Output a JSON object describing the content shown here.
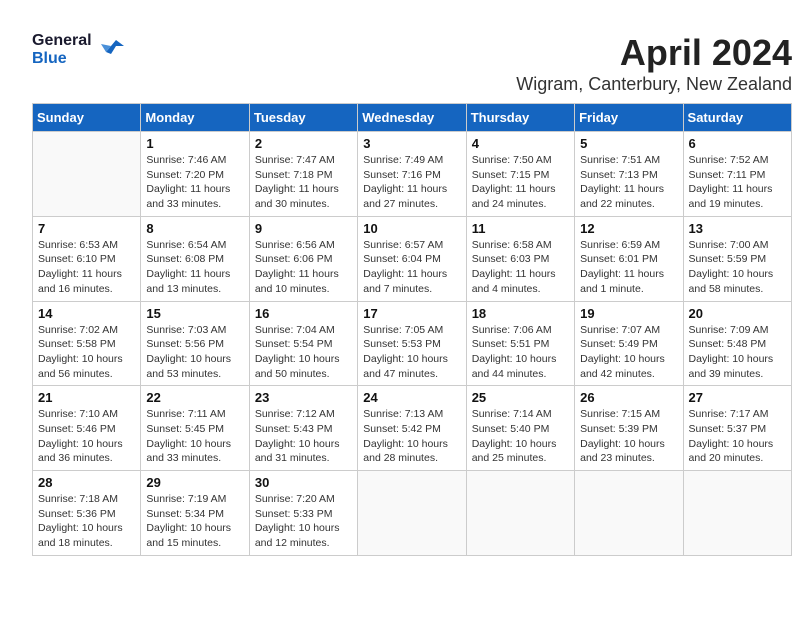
{
  "logo": {
    "general": "General",
    "blue": "Blue"
  },
  "header": {
    "month_year": "April 2024",
    "location": "Wigram, Canterbury, New Zealand"
  },
  "weekdays": [
    "Sunday",
    "Monday",
    "Tuesday",
    "Wednesday",
    "Thursday",
    "Friday",
    "Saturday"
  ],
  "weeks": [
    [
      {
        "day": "",
        "sunrise": "",
        "sunset": "",
        "daylight": ""
      },
      {
        "day": "1",
        "sunrise": "Sunrise: 7:46 AM",
        "sunset": "Sunset: 7:20 PM",
        "daylight": "Daylight: 11 hours and 33 minutes."
      },
      {
        "day": "2",
        "sunrise": "Sunrise: 7:47 AM",
        "sunset": "Sunset: 7:18 PM",
        "daylight": "Daylight: 11 hours and 30 minutes."
      },
      {
        "day": "3",
        "sunrise": "Sunrise: 7:49 AM",
        "sunset": "Sunset: 7:16 PM",
        "daylight": "Daylight: 11 hours and 27 minutes."
      },
      {
        "day": "4",
        "sunrise": "Sunrise: 7:50 AM",
        "sunset": "Sunset: 7:15 PM",
        "daylight": "Daylight: 11 hours and 24 minutes."
      },
      {
        "day": "5",
        "sunrise": "Sunrise: 7:51 AM",
        "sunset": "Sunset: 7:13 PM",
        "daylight": "Daylight: 11 hours and 22 minutes."
      },
      {
        "day": "6",
        "sunrise": "Sunrise: 7:52 AM",
        "sunset": "Sunset: 7:11 PM",
        "daylight": "Daylight: 11 hours and 19 minutes."
      }
    ],
    [
      {
        "day": "7",
        "sunrise": "Sunrise: 6:53 AM",
        "sunset": "Sunset: 6:10 PM",
        "daylight": "Daylight: 11 hours and 16 minutes."
      },
      {
        "day": "8",
        "sunrise": "Sunrise: 6:54 AM",
        "sunset": "Sunset: 6:08 PM",
        "daylight": "Daylight: 11 hours and 13 minutes."
      },
      {
        "day": "9",
        "sunrise": "Sunrise: 6:56 AM",
        "sunset": "Sunset: 6:06 PM",
        "daylight": "Daylight: 11 hours and 10 minutes."
      },
      {
        "day": "10",
        "sunrise": "Sunrise: 6:57 AM",
        "sunset": "Sunset: 6:04 PM",
        "daylight": "Daylight: 11 hours and 7 minutes."
      },
      {
        "day": "11",
        "sunrise": "Sunrise: 6:58 AM",
        "sunset": "Sunset: 6:03 PM",
        "daylight": "Daylight: 11 hours and 4 minutes."
      },
      {
        "day": "12",
        "sunrise": "Sunrise: 6:59 AM",
        "sunset": "Sunset: 6:01 PM",
        "daylight": "Daylight: 11 hours and 1 minute."
      },
      {
        "day": "13",
        "sunrise": "Sunrise: 7:00 AM",
        "sunset": "Sunset: 5:59 PM",
        "daylight": "Daylight: 10 hours and 58 minutes."
      }
    ],
    [
      {
        "day": "14",
        "sunrise": "Sunrise: 7:02 AM",
        "sunset": "Sunset: 5:58 PM",
        "daylight": "Daylight: 10 hours and 56 minutes."
      },
      {
        "day": "15",
        "sunrise": "Sunrise: 7:03 AM",
        "sunset": "Sunset: 5:56 PM",
        "daylight": "Daylight: 10 hours and 53 minutes."
      },
      {
        "day": "16",
        "sunrise": "Sunrise: 7:04 AM",
        "sunset": "Sunset: 5:54 PM",
        "daylight": "Daylight: 10 hours and 50 minutes."
      },
      {
        "day": "17",
        "sunrise": "Sunrise: 7:05 AM",
        "sunset": "Sunset: 5:53 PM",
        "daylight": "Daylight: 10 hours and 47 minutes."
      },
      {
        "day": "18",
        "sunrise": "Sunrise: 7:06 AM",
        "sunset": "Sunset: 5:51 PM",
        "daylight": "Daylight: 10 hours and 44 minutes."
      },
      {
        "day": "19",
        "sunrise": "Sunrise: 7:07 AM",
        "sunset": "Sunset: 5:49 PM",
        "daylight": "Daylight: 10 hours and 42 minutes."
      },
      {
        "day": "20",
        "sunrise": "Sunrise: 7:09 AM",
        "sunset": "Sunset: 5:48 PM",
        "daylight": "Daylight: 10 hours and 39 minutes."
      }
    ],
    [
      {
        "day": "21",
        "sunrise": "Sunrise: 7:10 AM",
        "sunset": "Sunset: 5:46 PM",
        "daylight": "Daylight: 10 hours and 36 minutes."
      },
      {
        "day": "22",
        "sunrise": "Sunrise: 7:11 AM",
        "sunset": "Sunset: 5:45 PM",
        "daylight": "Daylight: 10 hours and 33 minutes."
      },
      {
        "day": "23",
        "sunrise": "Sunrise: 7:12 AM",
        "sunset": "Sunset: 5:43 PM",
        "daylight": "Daylight: 10 hours and 31 minutes."
      },
      {
        "day": "24",
        "sunrise": "Sunrise: 7:13 AM",
        "sunset": "Sunset: 5:42 PM",
        "daylight": "Daylight: 10 hours and 28 minutes."
      },
      {
        "day": "25",
        "sunrise": "Sunrise: 7:14 AM",
        "sunset": "Sunset: 5:40 PM",
        "daylight": "Daylight: 10 hours and 25 minutes."
      },
      {
        "day": "26",
        "sunrise": "Sunrise: 7:15 AM",
        "sunset": "Sunset: 5:39 PM",
        "daylight": "Daylight: 10 hours and 23 minutes."
      },
      {
        "day": "27",
        "sunrise": "Sunrise: 7:17 AM",
        "sunset": "Sunset: 5:37 PM",
        "daylight": "Daylight: 10 hours and 20 minutes."
      }
    ],
    [
      {
        "day": "28",
        "sunrise": "Sunrise: 7:18 AM",
        "sunset": "Sunset: 5:36 PM",
        "daylight": "Daylight: 10 hours and 18 minutes."
      },
      {
        "day": "29",
        "sunrise": "Sunrise: 7:19 AM",
        "sunset": "Sunset: 5:34 PM",
        "daylight": "Daylight: 10 hours and 15 minutes."
      },
      {
        "day": "30",
        "sunrise": "Sunrise: 7:20 AM",
        "sunset": "Sunset: 5:33 PM",
        "daylight": "Daylight: 10 hours and 12 minutes."
      },
      {
        "day": "",
        "sunrise": "",
        "sunset": "",
        "daylight": ""
      },
      {
        "day": "",
        "sunrise": "",
        "sunset": "",
        "daylight": ""
      },
      {
        "day": "",
        "sunrise": "",
        "sunset": "",
        "daylight": ""
      },
      {
        "day": "",
        "sunrise": "",
        "sunset": "",
        "daylight": ""
      }
    ]
  ]
}
